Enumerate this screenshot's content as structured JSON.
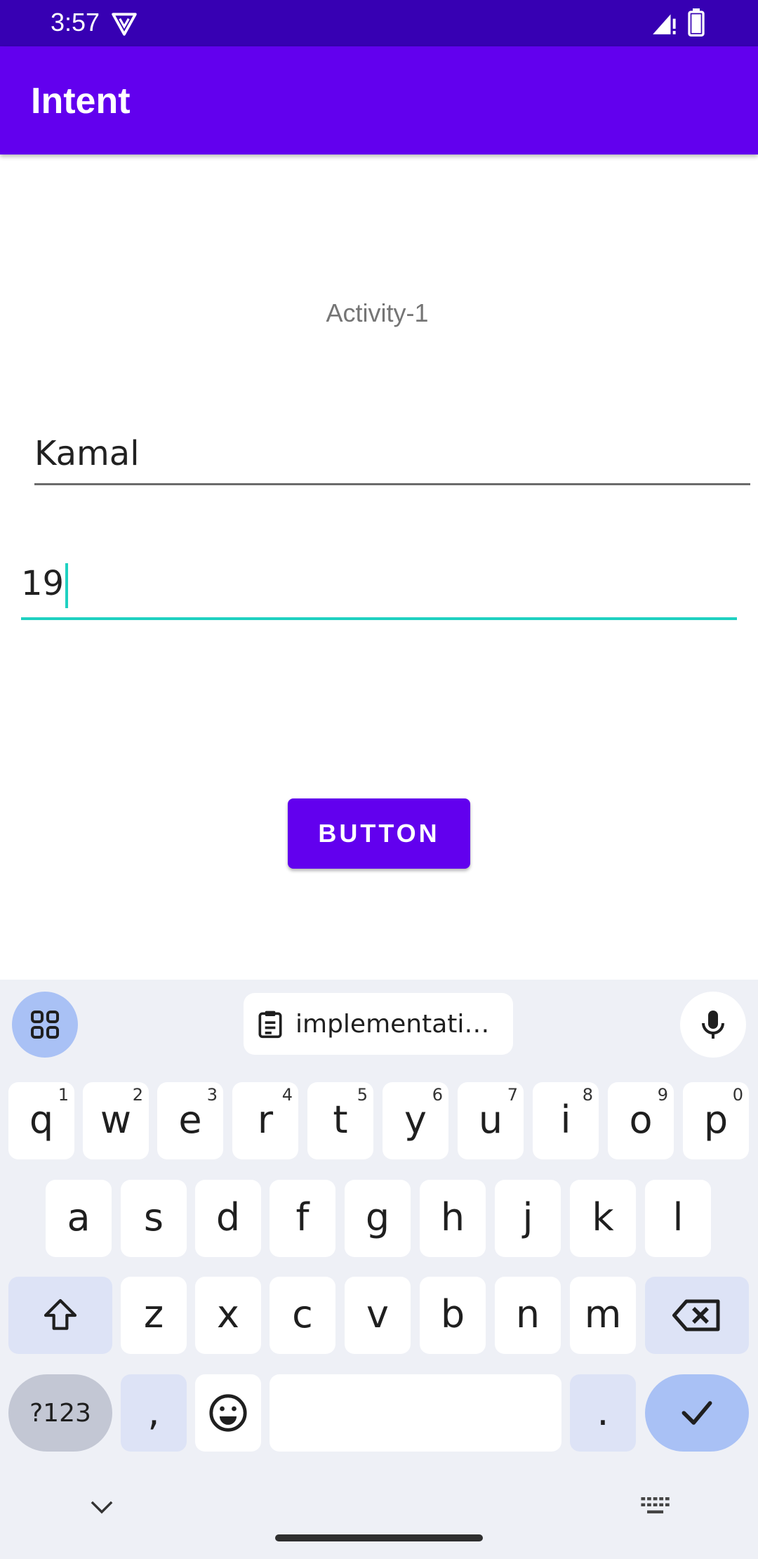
{
  "status_bar": {
    "time": "3:57"
  },
  "app_bar": {
    "title": "Intent"
  },
  "content": {
    "activity_label": "Activity-1",
    "name_field": {
      "value": "Kamal"
    },
    "age_field": {
      "value": "19"
    },
    "button_label": "BUTTON"
  },
  "keyboard": {
    "clipboard_suggestion": "implementati…",
    "row1": [
      {
        "label": "q",
        "hint": "1"
      },
      {
        "label": "w",
        "hint": "2"
      },
      {
        "label": "e",
        "hint": "3"
      },
      {
        "label": "r",
        "hint": "4"
      },
      {
        "label": "t",
        "hint": "5"
      },
      {
        "label": "y",
        "hint": "6"
      },
      {
        "label": "u",
        "hint": "7"
      },
      {
        "label": "i",
        "hint": "8"
      },
      {
        "label": "o",
        "hint": "9"
      },
      {
        "label": "p",
        "hint": "0"
      }
    ],
    "row2": [
      "a",
      "s",
      "d",
      "f",
      "g",
      "h",
      "j",
      "k",
      "l"
    ],
    "row3": [
      "z",
      "x",
      "c",
      "v",
      "b",
      "n",
      "m"
    ],
    "symbols_label": "?123",
    "comma_label": ",",
    "period_label": "."
  },
  "colors": {
    "status_bar": "#3700b3",
    "primary": "#6200ee",
    "accent": "#1fd1c1",
    "keyboard_bg": "#eef0f6"
  }
}
